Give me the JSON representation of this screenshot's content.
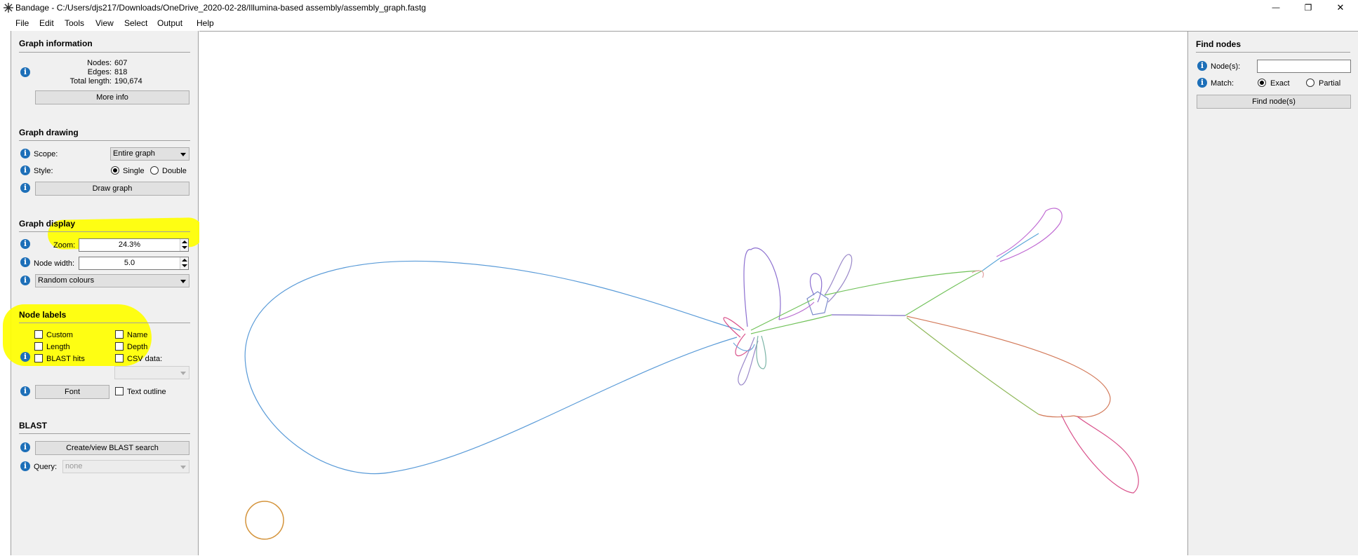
{
  "window": {
    "title": "Bandage - C:/Users/djs217/Downloads/OneDrive_2020-02-28/Illumina-based assembly/assembly_graph.fastg",
    "minimize_glyph": "—",
    "maximize_glyph": "❐",
    "close_glyph": "✕"
  },
  "menu": [
    "File",
    "Edit",
    "Tools",
    "View",
    "Select",
    "Output",
    "Help"
  ],
  "graph_information": {
    "header": "Graph information",
    "nodes_label": "Nodes:",
    "nodes_value": "607",
    "edges_label": "Edges:",
    "edges_value": "818",
    "length_label": "Total length:",
    "length_value": "190,674",
    "more_info": "More info"
  },
  "graph_drawing": {
    "header": "Graph drawing",
    "scope_label": "Scope:",
    "scope_value": "Entire graph",
    "style_label": "Style:",
    "style_single": "Single",
    "style_double": "Double",
    "style_selected": "Single",
    "draw_graph": "Draw graph"
  },
  "graph_display": {
    "header": "Graph display",
    "zoom_label": "Zoom:",
    "zoom_value": "24.3%",
    "node_width_label": "Node width:",
    "node_width_value": "5.0",
    "colour_scheme": "Random colours"
  },
  "node_labels": {
    "header": "Node labels",
    "custom": "Custom",
    "name": "Name",
    "length": "Length",
    "depth": "Depth",
    "blast_hits": "BLAST hits",
    "csv_data": "CSV data:",
    "font": "Font",
    "text_outline": "Text outline"
  },
  "blast": {
    "header": "BLAST",
    "create_view": "Create/view BLAST search",
    "query_label": "Query:",
    "query_value": "none"
  },
  "find_nodes": {
    "header": "Find nodes",
    "nodes_label": "Node(s):",
    "nodes_value": "",
    "match_label": "Match:",
    "exact": "Exact",
    "partial": "Partial",
    "match_selected": "Exact",
    "find_button": "Find node(s)"
  },
  "icons": {
    "info": "info-icon",
    "app": "bandage-app-icon"
  },
  "colors": {
    "highlight": "#ffff00",
    "info_icon": "#1d6fb8",
    "panel_bg": "#f0f0f0"
  }
}
